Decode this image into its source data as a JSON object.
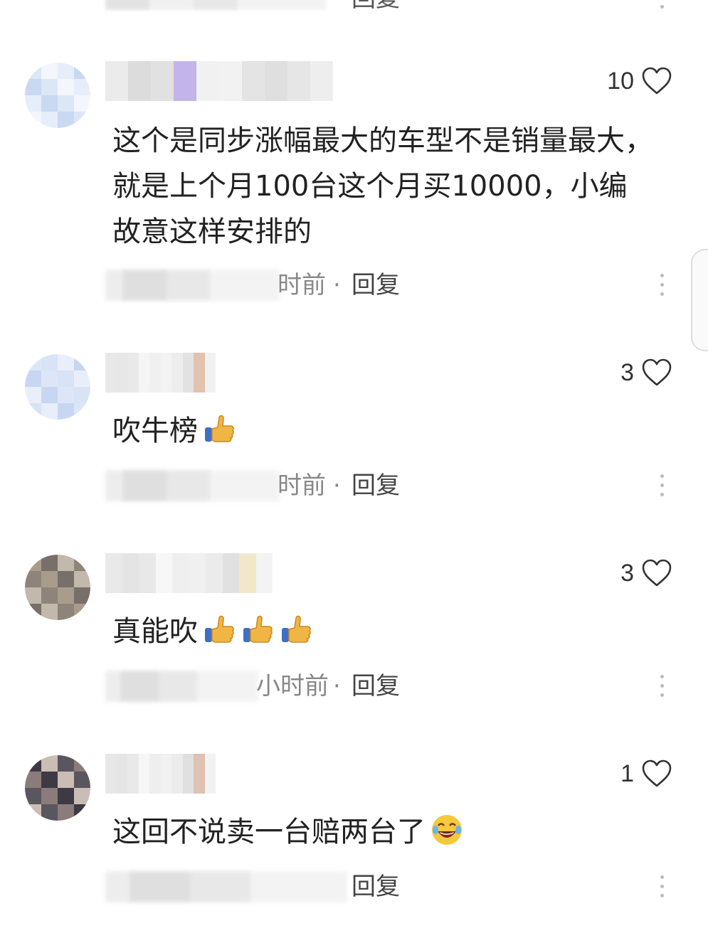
{
  "partial_top": {
    "reply_label": "回复"
  },
  "comments": [
    {
      "likes": "10",
      "text": "这个是同步涨幅最大的车型不是销量最大，就是上个月100台这个月买10000，小编故意这样安排的",
      "time": "时前",
      "reply_label": "回复",
      "avatar_colors": [
        "#dbe6f7",
        "#c9d9f2",
        "#e7eefb",
        "#f3f6fc"
      ],
      "name_colors": [
        "#e8e8e8",
        "#dadada",
        "#efefef",
        "#d6d6d6",
        "#e2e2e2",
        "#f0f0f0",
        "#dcdcdc",
        "#ececec",
        "#e0e0e0",
        "#b9a8e6"
      ]
    },
    {
      "likes": "3",
      "text": "吹牛榜",
      "emoji": [
        "thumbs-up"
      ],
      "time": "时前",
      "reply_label": "回复",
      "avatar_colors": [
        "#dce6f8",
        "#c8d6f1",
        "#e9effa",
        "#d9e3f6"
      ],
      "name_colors": [
        "#e5e5e5",
        "#dddddd",
        "#eeeeee",
        "#e3e3e3",
        "#ddb9a1",
        "#f1f1f1",
        "#e6e6e6",
        "#efefef",
        "#ebebeb",
        "#f4f4f4"
      ]
    },
    {
      "likes": "3",
      "text": "真能吹",
      "emoji": [
        "thumbs-up",
        "thumbs-up",
        "thumbs-up"
      ],
      "time": "小时前",
      "reply_label": "回复",
      "avatar_colors": [
        "#a99c8d",
        "#8f847a",
        "#c2b8ab",
        "#77706a"
      ],
      "name_colors": [
        "#e6e6e6",
        "#dcdcdc",
        "#ededed",
        "#e0e0e0",
        "#f0e4c0",
        "#eeeeee",
        "#e4e4e4",
        "#f2f2f2",
        "#e8e8e8",
        "#f6f6f6"
      ]
    },
    {
      "likes": "1",
      "text": "这回不说卖一台赔两台了",
      "emoji": [
        "laughing-tears"
      ],
      "time": "",
      "reply_label": "回复",
      "avatar_colors": [
        "#3e3a45",
        "#8a7c78",
        "#5a5660",
        "#c9bdb5"
      ],
      "name_colors": [
        "#e3e3e3",
        "#dbdbdb",
        "#ececec",
        "#e1e1e1",
        "#d9b8a6",
        "#efefef",
        "#e6e6e6",
        "#f0f0f0",
        "#e9e9e9",
        "#f5f5f5"
      ]
    }
  ],
  "icons": {
    "heart": "heart-outline-icon",
    "more": "more-vertical-icon"
  }
}
